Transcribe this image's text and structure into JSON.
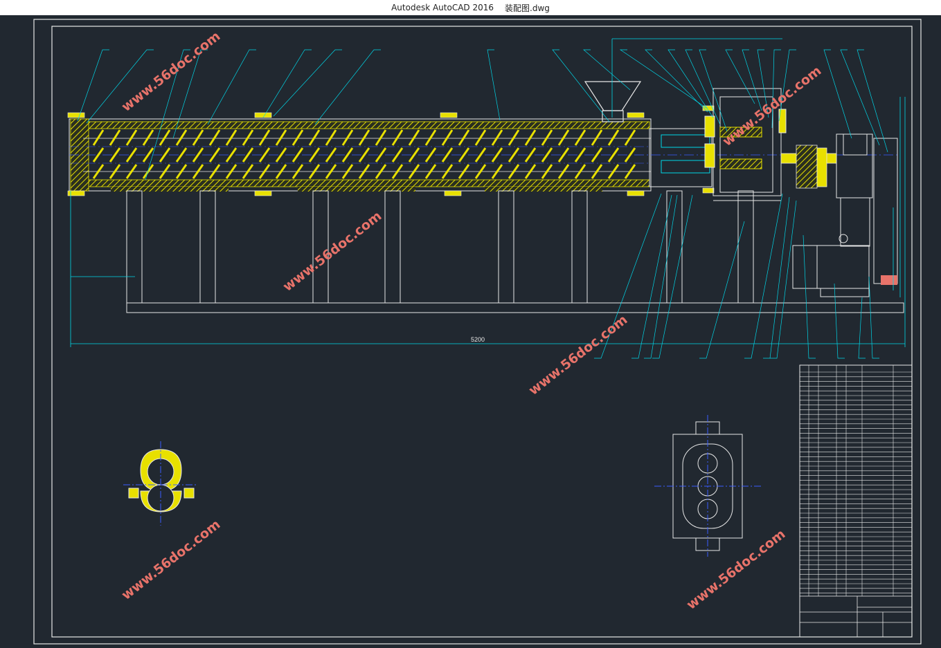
{
  "window": {
    "app_title": "Autodesk AutoCAD 2016",
    "file_name": "装配图.dwg"
  },
  "drawing": {
    "overall_length_dim": "5200",
    "watermark": "www.56doc.com"
  },
  "colors": {
    "canvas": "#212830",
    "line_white": "#e8e8e8",
    "line_cyan": "#00d7e8",
    "line_yellow": "#e8e000",
    "line_blue": "#3b5bff",
    "watermark": "#e8736a"
  }
}
